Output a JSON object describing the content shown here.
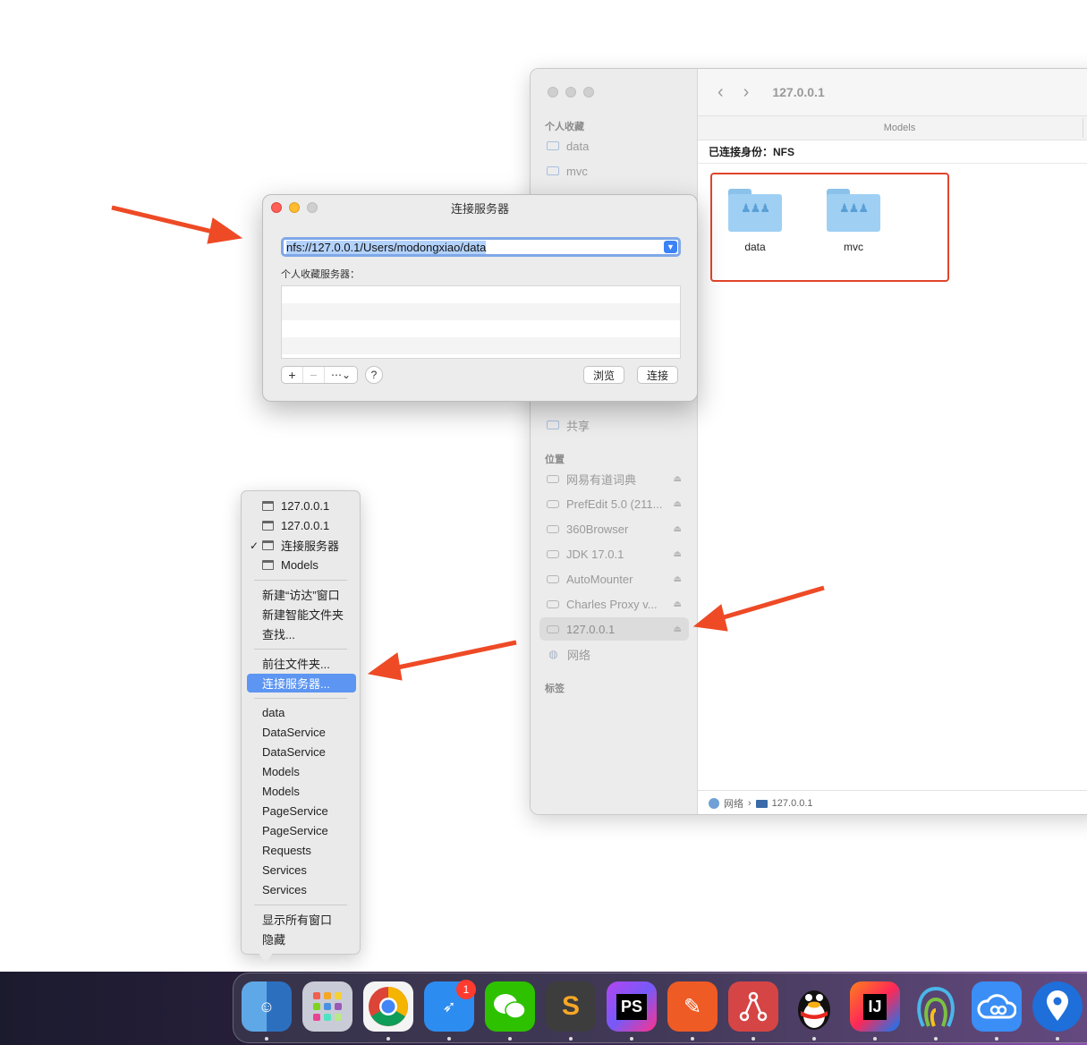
{
  "finder": {
    "title": "127.0.0.1",
    "column_header": "Models",
    "connected_as": "已连接身份：NFS",
    "items": [
      {
        "label": "data"
      },
      {
        "label": "mvc"
      }
    ],
    "pathbar": {
      "network": "网络",
      "sep": "›",
      "server": "127.0.0.1"
    },
    "sidebar": {
      "favorites_head": "个人收藏",
      "favorites": [
        "data",
        "mvc"
      ],
      "share": "共享",
      "locations_head": "位置",
      "locations": [
        "网易有道词典",
        "PrefEdit 5.0 (211...",
        "360Browser",
        "JDK 17.0.1",
        "AutoMounter",
        "Charles Proxy v..."
      ],
      "server": "127.0.0.1",
      "network": "网络",
      "tags_head": "标签"
    }
  },
  "dialog": {
    "title": "连接服务器",
    "address": "nfs://127.0.0.1/Users/modongxiao/data",
    "favorites_label": "个人收藏服务器：",
    "add": "+",
    "remove": "−",
    "more": "⋯⌄",
    "help": "?",
    "browse": "浏览",
    "connect": "连接"
  },
  "menu": {
    "windows": [
      "127.0.0.1",
      "127.0.0.1",
      "连接服务器",
      "Models"
    ],
    "checked": "✓",
    "actions1": [
      "新建“访达”窗口",
      "新建智能文件夹",
      "查找..."
    ],
    "actions2": [
      "前往文件夹...",
      "连接服务器..."
    ],
    "recent": [
      "data",
      "DataService",
      "DataService",
      "Models",
      "Models",
      "PageService",
      "PageService",
      "Requests",
      "Services",
      "Services"
    ],
    "actions3": [
      "显示所有窗口",
      "隐藏"
    ]
  },
  "dock": {
    "badge": "1",
    "apps": [
      {
        "icon": "finder-icon",
        "label": ""
      },
      {
        "icon": "launchpad-icon",
        "label": ""
      },
      {
        "icon": "chrome-icon",
        "label": ""
      },
      {
        "icon": "dingtalk-icon",
        "label": ""
      },
      {
        "icon": "wechat-icon",
        "label": ""
      },
      {
        "icon": "sublime-icon",
        "label": "S"
      },
      {
        "icon": "phpstorm-icon",
        "label": "PS"
      },
      {
        "icon": "postman-icon",
        "label": ""
      },
      {
        "icon": "sourcetree-icon",
        "label": ""
      },
      {
        "icon": "qq-icon",
        "label": ""
      },
      {
        "icon": "intellij-icon",
        "label": "IJ"
      },
      {
        "icon": "navicat-icon",
        "label": ""
      },
      {
        "icon": "baidu-netdisk-icon",
        "label": ""
      },
      {
        "icon": "location-icon",
        "label": ""
      }
    ]
  },
  "colors": {
    "highlight": "#5d95f2",
    "annotation_red": "#e0452c",
    "annotation_arrow": "#ee4a26"
  }
}
